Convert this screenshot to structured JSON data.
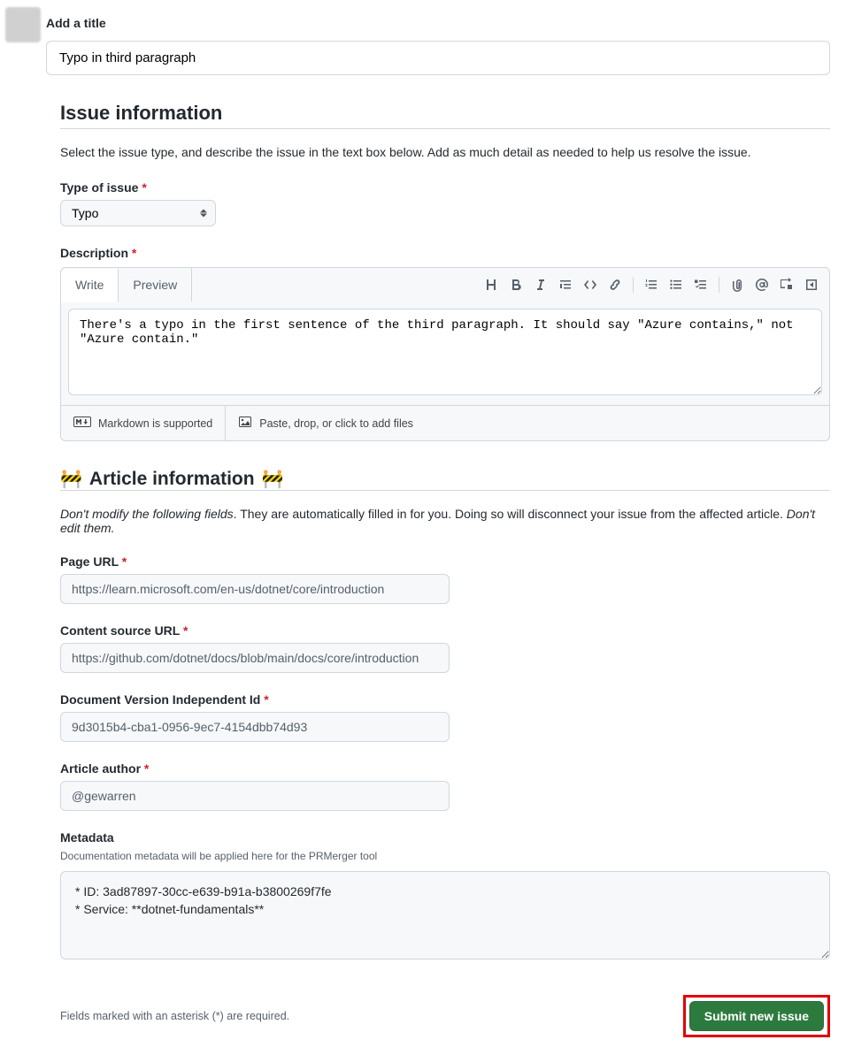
{
  "title_section": {
    "label": "Add a title",
    "value": "Typo in third paragraph"
  },
  "issue_info": {
    "heading": "Issue information",
    "description": "Select the issue type, and describe the issue in the text box below. Add as much detail as needed to help us resolve the issue.",
    "type_label": "Type of issue",
    "type_value": "Typo",
    "desc_label": "Description",
    "tabs": {
      "write": "Write",
      "preview": "Preview"
    },
    "textarea_value": "There's a typo in the first sentence of the third paragraph. It should say \"Azure contains,\" not \"Azure contain.\"",
    "markdown_note": "Markdown is supported",
    "attach_note": "Paste, drop, or click to add files"
  },
  "article_info": {
    "heading": "Article information",
    "note_em1": "Don't modify the following fields",
    "note_rest": ". They are automatically filled in for you. Doing so will disconnect your issue from the affected article. ",
    "note_em2": "Don't edit them.",
    "page_url_label": "Page URL",
    "page_url_value": "https://learn.microsoft.com/en-us/dotnet/core/introduction",
    "source_url_label": "Content source URL",
    "source_url_value": "https://github.com/dotnet/docs/blob/main/docs/core/introduction",
    "doc_version_label": "Document Version Independent Id",
    "doc_version_value": "9d3015b4-cba1-0956-9ec7-4154dbb74d93",
    "author_label": "Article author",
    "author_value": "@gewarren",
    "metadata_label": "Metadata",
    "metadata_help": "Documentation metadata will be applied here for the PRMerger tool",
    "metadata_line1": "* ID: 3ad87897-30cc-e639-b91a-b3800269f7fe",
    "metadata_line2": "* Service: **dotnet-fundamentals**"
  },
  "footer": {
    "asterisk_note": "Fields marked with an asterisk (*) are required.",
    "submit_label": "Submit new issue"
  }
}
